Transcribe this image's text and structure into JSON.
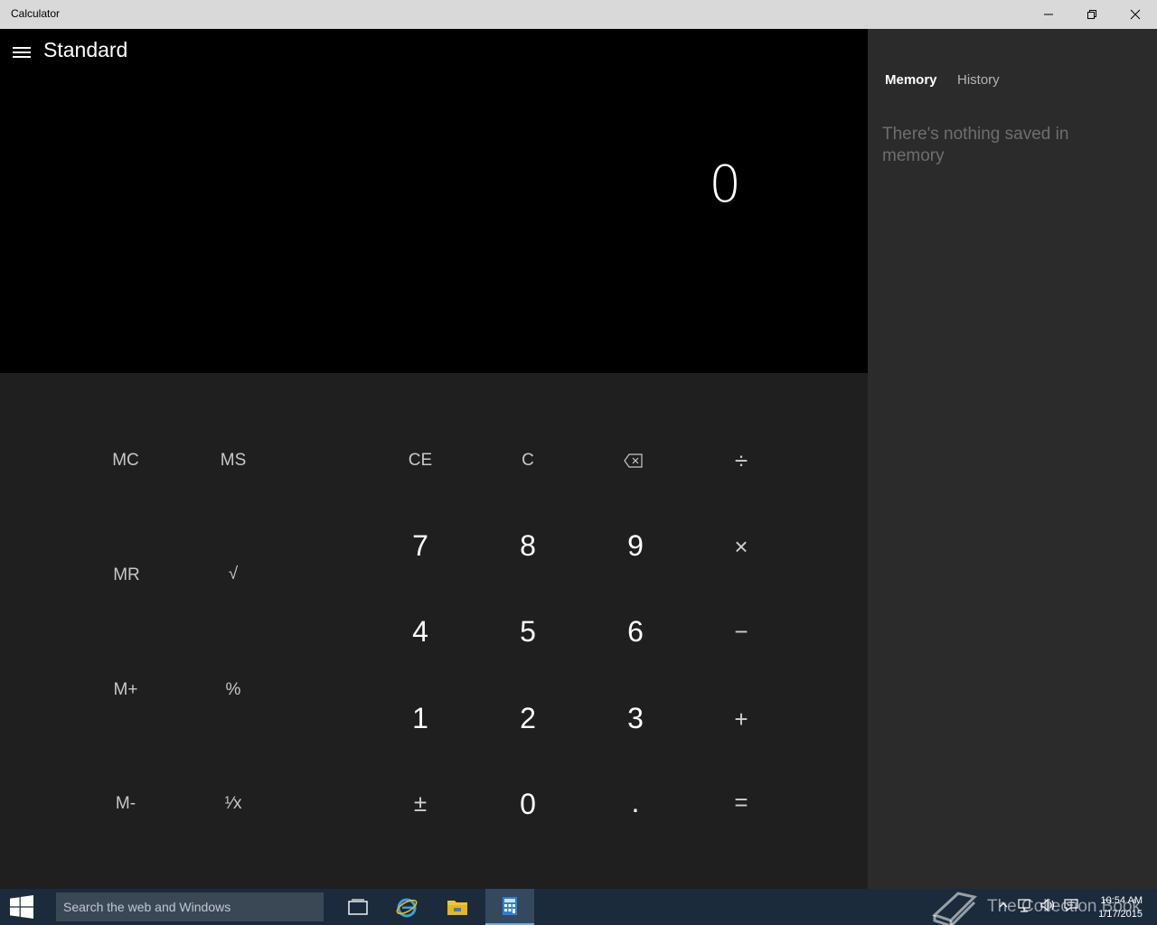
{
  "window": {
    "title": "Calculator"
  },
  "calculator": {
    "mode": "Standard",
    "display_value": "0"
  },
  "keys": {
    "mc": "MC",
    "ms": "MS",
    "mr": "MR",
    "sqrt": "√",
    "mplus": "M+",
    "percent": "%",
    "mminus": "M-",
    "reciprocal": "¹⁄x",
    "ce": "CE",
    "c": "C",
    "backspace": "⌫",
    "divide": "÷",
    "seven": "7",
    "eight": "8",
    "nine": "9",
    "multiply": "×",
    "four": "4",
    "five": "5",
    "six": "6",
    "minus": "−",
    "one": "1",
    "two": "2",
    "three": "3",
    "plus": "+",
    "negate": "±",
    "zero": "0",
    "decimal": ".",
    "equals": "="
  },
  "side_panel": {
    "tabs": [
      {
        "label": "Memory",
        "active": true
      },
      {
        "label": "History",
        "active": false
      }
    ],
    "empty_message": "There's nothing saved in memory"
  },
  "taskbar": {
    "search_placeholder": "Search the web and Windows",
    "apps": [
      "task-view",
      "internet-explorer",
      "file-explorer",
      "calculator"
    ],
    "watermark": "The Collection Book",
    "time": "10:54 AM",
    "date": "1/17/2015"
  }
}
